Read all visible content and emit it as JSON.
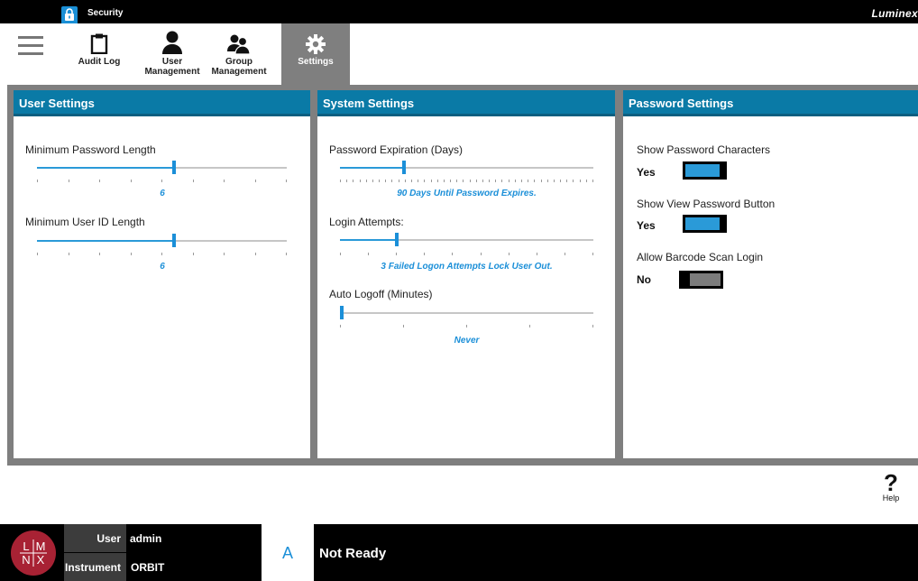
{
  "titlebar": {
    "title": "Security",
    "brand": "Luminex"
  },
  "toolbar": {
    "menu_icon": "hamburger-menu-icon",
    "items": [
      {
        "label": "Audit Log",
        "icon": "clipboard-icon",
        "active": false
      },
      {
        "label": "User Management",
        "icon": "user-icon",
        "active": false
      },
      {
        "label": "Group Management",
        "icon": "group-icon",
        "active": false
      },
      {
        "label": "Settings",
        "icon": "gear-icon",
        "active": true
      }
    ]
  },
  "user_settings": {
    "title": "User Settings",
    "min_password_length": {
      "label": "Minimum Password Length",
      "value_text": "6",
      "fraction": 0.55
    },
    "min_user_id_length": {
      "label": "Minimum User ID Length",
      "value_text": "6",
      "fraction": 0.55
    }
  },
  "system_settings": {
    "title": "System Settings",
    "password_expiration": {
      "label": "Password Expiration (Days)",
      "value_text": "90 Days Until Password Expires.",
      "fraction": 0.25
    },
    "login_attempts": {
      "label": "Login Attempts:",
      "value_text": "3 Failed Logon Attempts Lock User Out.",
      "fraction": 0.22
    },
    "auto_logoff": {
      "label": "Auto Logoff (Minutes)",
      "value_text": "Never",
      "fraction": 0.0
    }
  },
  "password_settings": {
    "title": "Password Settings",
    "show_password_chars": {
      "label": "Show Password Characters",
      "value": "Yes",
      "on": true
    },
    "show_view_password_button": {
      "label": "Show View Password Button",
      "value": "Yes",
      "on": true
    },
    "allow_barcode_scan_login": {
      "label": "Allow Barcode Scan Login",
      "value": "No",
      "on": false
    }
  },
  "help": {
    "symbol": "?",
    "label": "Help"
  },
  "status": {
    "logo_text": "LMNX",
    "user_label": "User",
    "user_value": "admin",
    "instrument_label": "Instrument",
    "instrument_value": "ORBIT",
    "avatar_letter": "A",
    "state": "Not Ready"
  },
  "colors": {
    "accent": "#1b8fd8",
    "header": "#0a7aa6",
    "logo": "#a82234"
  }
}
